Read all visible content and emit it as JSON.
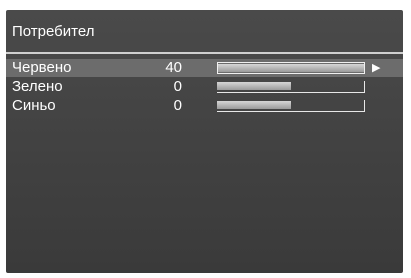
{
  "menu": {
    "title": "Потребител",
    "items": [
      {
        "label": "Червено",
        "value": "40",
        "level": 1.0,
        "selected": true,
        "arrow": "▶"
      },
      {
        "label": "Зелено",
        "value": "0",
        "level": 0.5,
        "selected": false
      },
      {
        "label": "Синьо",
        "value": "0",
        "level": 0.5,
        "selected": false
      }
    ]
  },
  "colors": {
    "panel_background": "#404040",
    "selected_row": "#6c6c6c",
    "text": "#ffffff"
  },
  "icons": {
    "selection_arrow": "right-triangle-icon"
  }
}
